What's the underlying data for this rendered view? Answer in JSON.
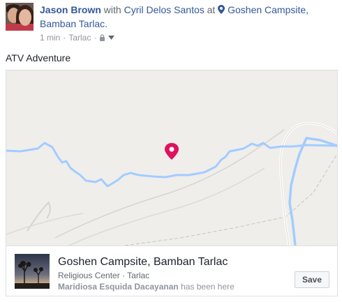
{
  "post": {
    "author": "Jason Brown",
    "with_word": "with",
    "tagged": "Cyril Delos Santos",
    "at_word": "at",
    "place_link": "Goshen Campsite, Bamban Tarlac",
    "place_link_end": ".",
    "time": "1 min",
    "location": "Tarlac",
    "privacy_icon": "lock-icon",
    "body": "ATV Adventure"
  },
  "place_card": {
    "title": "Goshen Campsite, Bamban Tarlac",
    "category": "Religious Center · Tarlac",
    "visitor_name": "Maridiosa Esquida Dacayanan",
    "visitor_suffix": "has been here",
    "save_label": "Save"
  },
  "colors": {
    "link": "#365899",
    "map_background": "#efeeeb",
    "river": "#a3ccff",
    "map_pin": "#e0115f"
  }
}
